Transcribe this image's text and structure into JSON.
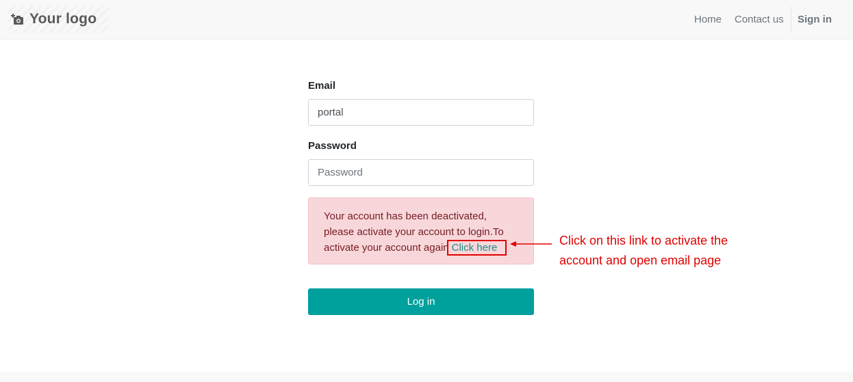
{
  "navbar": {
    "logo_text": "Your logo",
    "logo_icon": "camera-icon",
    "links": {
      "home": "Home",
      "contact": "Contact us",
      "signin": "Sign in"
    }
  },
  "form": {
    "email_label": "Email",
    "email_value": "portal",
    "password_label": "Password",
    "password_placeholder": "Password",
    "alert_text": "Your account has been deactivated, please activate your account to login.To activate your account again",
    "alert_link": "Click here",
    "login_button": "Log in"
  },
  "annotation": {
    "text": "Click on this link to activate the account and open email page"
  },
  "colors": {
    "accent": "#00a09d",
    "alert_bg": "#f8d7da",
    "alert_text": "#721c24",
    "annotation_red": "#e00000"
  }
}
